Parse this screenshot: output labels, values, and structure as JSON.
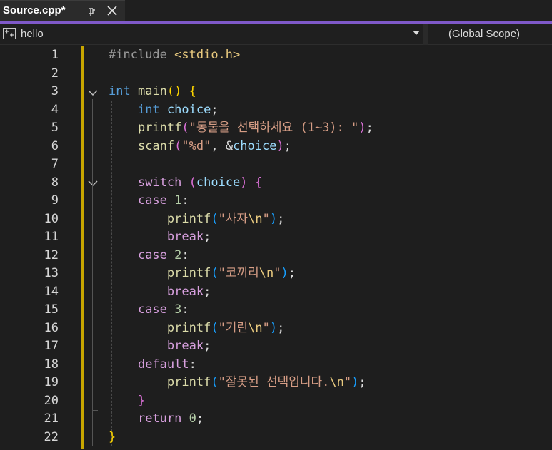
{
  "tab": {
    "title": "Source.cpp*"
  },
  "nav": {
    "project": "hello",
    "scope": "(Global Scope)"
  },
  "line_numbers": [
    "1",
    "2",
    "3",
    "4",
    "5",
    "6",
    "7",
    "8",
    "9",
    "10",
    "11",
    "12",
    "13",
    "14",
    "15",
    "16",
    "17",
    "18",
    "19",
    "20",
    "21",
    "22"
  ],
  "code": {
    "l1": {
      "a": "#include",
      "b": " ",
      "c": "<stdio.h>"
    },
    "l3": {
      "a": "int",
      "b": " ",
      "c": "main",
      "d": "()",
      "e": " ",
      "f": "{"
    },
    "l4": {
      "a": "    ",
      "b": "int",
      "c": " ",
      "d": "choice",
      "e": ";"
    },
    "l5": {
      "a": "    ",
      "b": "printf",
      "c": "(",
      "d": "\"동물을 선택하세요 (1~3): \"",
      "e": ")",
      "f": ";"
    },
    "l6": {
      "a": "    ",
      "b": "scanf",
      "c": "(",
      "d": "\"%d\"",
      "e": ", &",
      "f": "choice",
      "g": ")",
      "h": ";"
    },
    "l8": {
      "a": "    ",
      "b": "switch",
      "c": " ",
      "d": "(",
      "e": "choice",
      "f": ")",
      "g": " ",
      "h": "{"
    },
    "l9": {
      "a": "    ",
      "b": "case",
      "c": " ",
      "d": "1",
      "e": ":"
    },
    "l10": {
      "a": "        ",
      "b": "printf",
      "c": "(",
      "d": "\"사자",
      "e": "\\n",
      "f": "\"",
      "g": ")",
      "h": ";"
    },
    "l11": {
      "a": "        ",
      "b": "break",
      "c": ";"
    },
    "l12": {
      "a": "    ",
      "b": "case",
      "c": " ",
      "d": "2",
      "e": ":"
    },
    "l13": {
      "a": "        ",
      "b": "printf",
      "c": "(",
      "d": "\"코끼리",
      "e": "\\n",
      "f": "\"",
      "g": ")",
      "h": ";"
    },
    "l14": {
      "a": "        ",
      "b": "break",
      "c": ";"
    },
    "l15": {
      "a": "    ",
      "b": "case",
      "c": " ",
      "d": "3",
      "e": ":"
    },
    "l16": {
      "a": "        ",
      "b": "printf",
      "c": "(",
      "d": "\"기린",
      "e": "\\n",
      "f": "\"",
      "g": ")",
      "h": ";"
    },
    "l17": {
      "a": "        ",
      "b": "break",
      "c": ";"
    },
    "l18": {
      "a": "    ",
      "b": "default",
      "c": ":"
    },
    "l19": {
      "a": "        ",
      "b": "printf",
      "c": "(",
      "d": "\"잘못된 선택입니다.",
      "e": "\\n",
      "f": "\"",
      "g": ")",
      "h": ";"
    },
    "l20": {
      "a": "    ",
      "b": "}"
    },
    "l21": {
      "a": "    ",
      "b": "return",
      "c": " ",
      "d": "0",
      "e": ";"
    },
    "l22": {
      "a": "}"
    }
  },
  "icons": {
    "pin": "pin-icon",
    "close": "close-icon",
    "project": "project-icon",
    "fold": "chevron-down-icon"
  },
  "colors": {
    "accent": "#7f59c9",
    "change_bar": "#c8a600",
    "background": "#1e1e1e"
  }
}
